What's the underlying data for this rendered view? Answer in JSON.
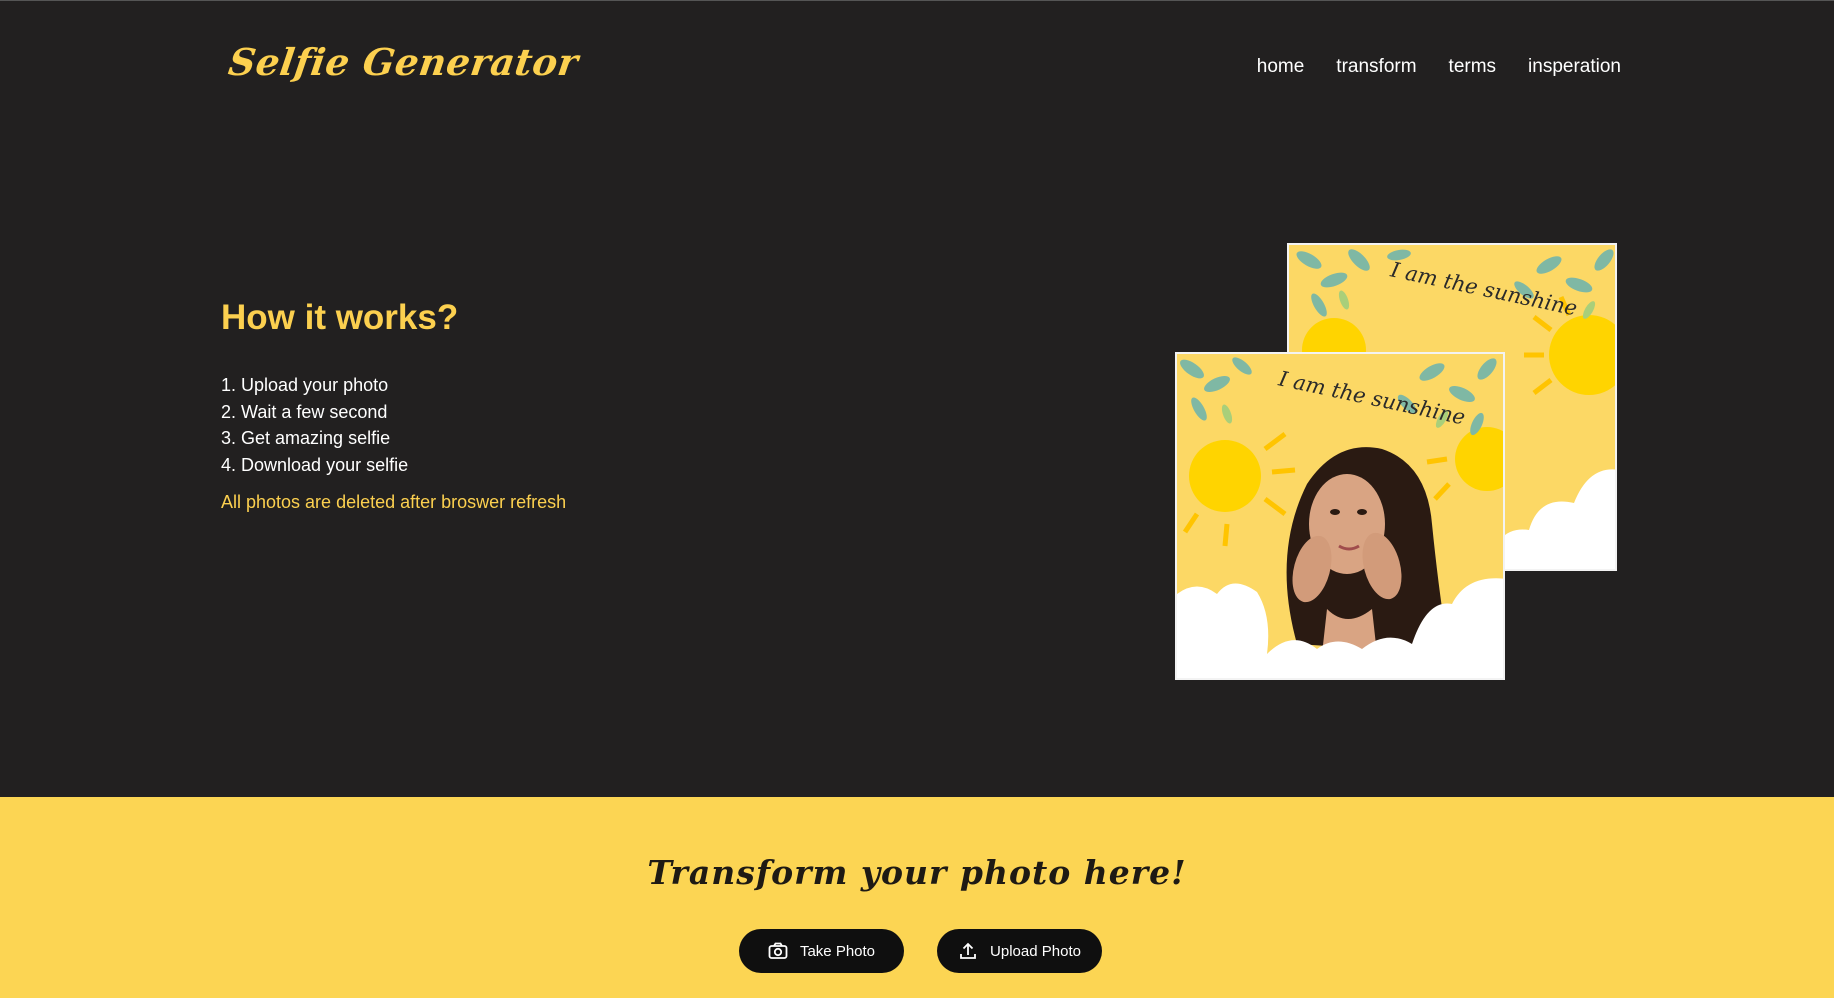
{
  "header": {
    "logo": "Selfie Generator",
    "nav": [
      "home",
      "transform",
      "terms",
      "insperation"
    ]
  },
  "hero": {
    "title": "How it works?",
    "steps": [
      "1. Upload your photo",
      "2. Wait a few second",
      "3. Get amazing selfie",
      "4. Download your selfie"
    ],
    "note": "All photos are deleted after broswer refresh",
    "card_caption": "I am the sunshine"
  },
  "transform": {
    "title": "Transform your photo here!",
    "take_photo_label": "Take Photo",
    "upload_photo_label": "Upload Photo"
  },
  "colors": {
    "background": "#222020",
    "accent": "#fcd04f",
    "band": "#fcd553",
    "button": "#0f0f0f"
  },
  "icons": [
    "camera-icon",
    "upload-icon"
  ]
}
